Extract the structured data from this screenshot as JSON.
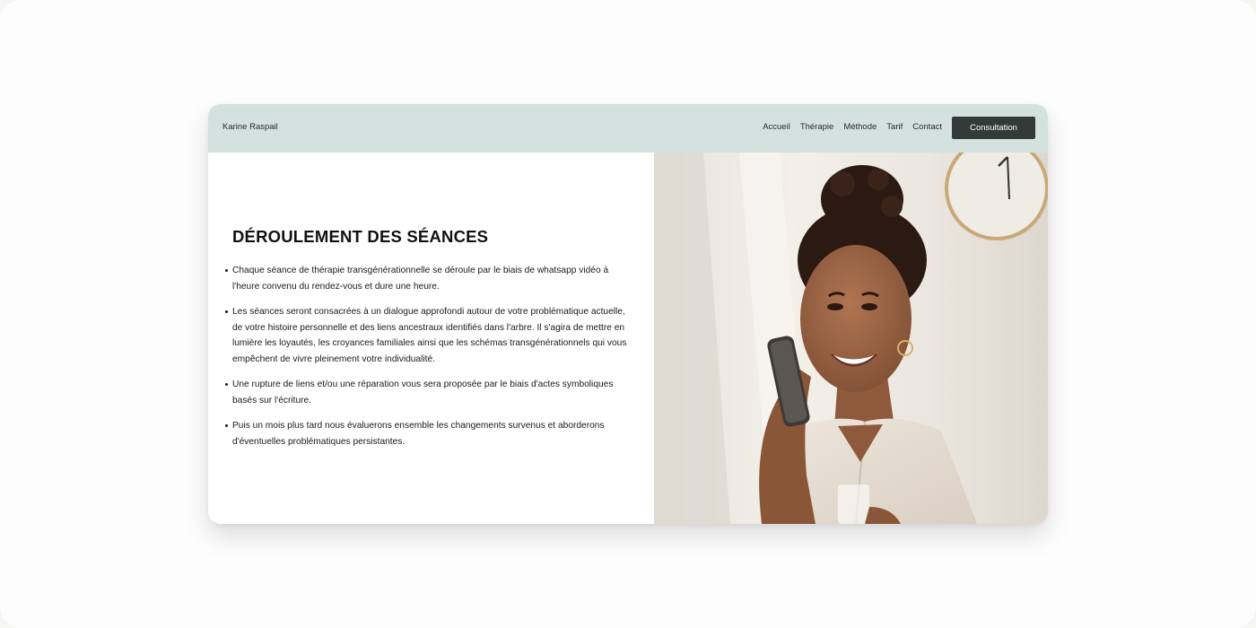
{
  "site": {
    "brand": "Karine Raspail",
    "nav": [
      "Accueil",
      "Thérapie",
      "Méthode",
      "Tarif",
      "Contact"
    ],
    "cta_label": "Consultation"
  },
  "main": {
    "title": "DÉROULEMENT DES SÉANCES",
    "bullets": [
      "Chaque séance de thérapie transgénérationnelle se déroule par le biais de whatsapp vidéo à l'heure convenu du rendez-vous et dure une heure.",
      "Les séances seront consacrées à un dialogue approfondi autour de votre problématique actuelle, de votre histoire personnelle et des liens ancestraux identifiés dans l'arbre. Il s'agira de mettre en lumière les loyautés, les croyances familiales ainsi que les schémas transgénérationnels qui vous empêchent de vivre pleinement votre individualité.",
      "Une rupture de liens et/ou une réparation vous sera proposée par le biais d'actes symboliques basés sur l'écriture.",
      "Puis un mois plus tard nous évaluerons ensemble les changements survenus et aborderons d'éventuelles problématiques persistantes."
    ]
  },
  "colors": {
    "header_bg": "#d3e2df",
    "cta_bg": "#333a38",
    "page_bg": "#f6f6f5"
  }
}
